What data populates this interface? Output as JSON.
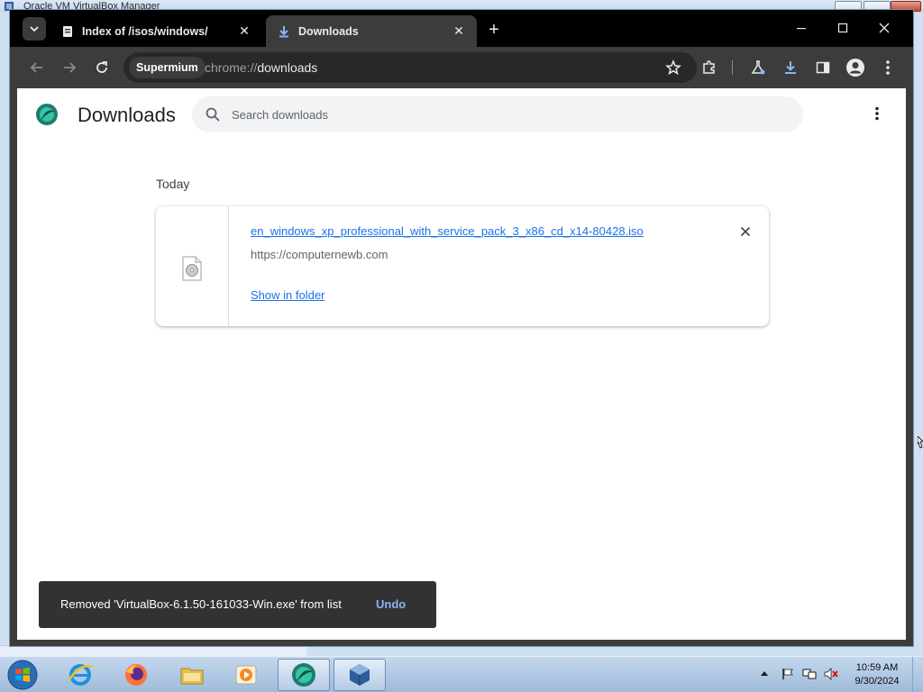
{
  "background_window": {
    "title": "Oracle VM VirtualBox Manager"
  },
  "tabs": [
    {
      "title": "Index of /isos/windows/",
      "icon": "page-icon"
    },
    {
      "title": "Downloads",
      "icon": "download-icon",
      "active": true
    }
  ],
  "toolbar": {
    "site_chip": "Supermium",
    "url_prefix": "chrome://",
    "url_main": "downloads"
  },
  "page": {
    "title": "Downloads",
    "search_placeholder": "Search downloads",
    "date_header": "Today",
    "download": {
      "file_name": "en_windows_xp_professional_with_service_pack_3_x86_cd_x14-80428.iso",
      "source": "https://computernewb.com",
      "action": "Show in folder"
    },
    "toast": {
      "message": "Removed 'VirtualBox-6.1.50-161033-Win.exe' from list",
      "action": "Undo"
    }
  },
  "taskbar": {
    "apps": [
      "internet-explorer",
      "firefox",
      "file-explorer",
      "media-player",
      "supermium",
      "virtualbox"
    ],
    "clock_time": "10:59 AM",
    "clock_date": "9/30/2024"
  },
  "colors": {
    "accent": "#1a73e8",
    "toolbar": "#3c3c3c",
    "tabstrip": "#000000",
    "toast": "#323232",
    "undo": "#8ab4f8"
  }
}
